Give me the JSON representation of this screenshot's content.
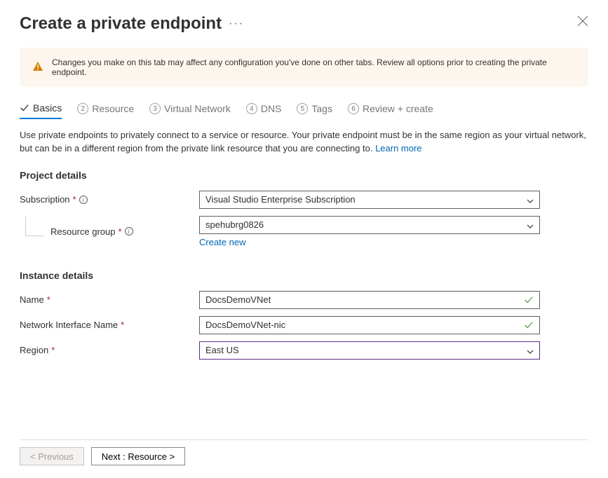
{
  "header": {
    "title": "Create a private endpoint"
  },
  "warning": {
    "text": "Changes you make on this tab may affect any configuration you've done on other tabs. Review all options prior to creating the private endpoint."
  },
  "tabs": {
    "basics": "Basics",
    "resource": "Resource",
    "vnet": "Virtual Network",
    "dns": "DNS",
    "tags": "Tags",
    "review": "Review + create",
    "num2": "2",
    "num3": "3",
    "num4": "4",
    "num5": "5",
    "num6": "6"
  },
  "description": {
    "text": "Use private endpoints to privately connect to a service or resource. Your private endpoint must be in the same region as your virtual network, but can be in a different region from the private link resource that you are connecting to.  ",
    "learn_more": "Learn more"
  },
  "sections": {
    "project": "Project details",
    "instance": "Instance details"
  },
  "labels": {
    "subscription": "Subscription",
    "resource_group": "Resource group",
    "name": "Name",
    "nic_name": "Network Interface Name",
    "region": "Region",
    "create_new": "Create new"
  },
  "values": {
    "subscription": "Visual Studio Enterprise Subscription",
    "resource_group": "spehubrg0826",
    "name": "DocsDemoVNet",
    "nic_name": "DocsDemoVNet-nic",
    "region": "East US"
  },
  "footer": {
    "previous": "< Previous",
    "next": "Next : Resource >"
  }
}
